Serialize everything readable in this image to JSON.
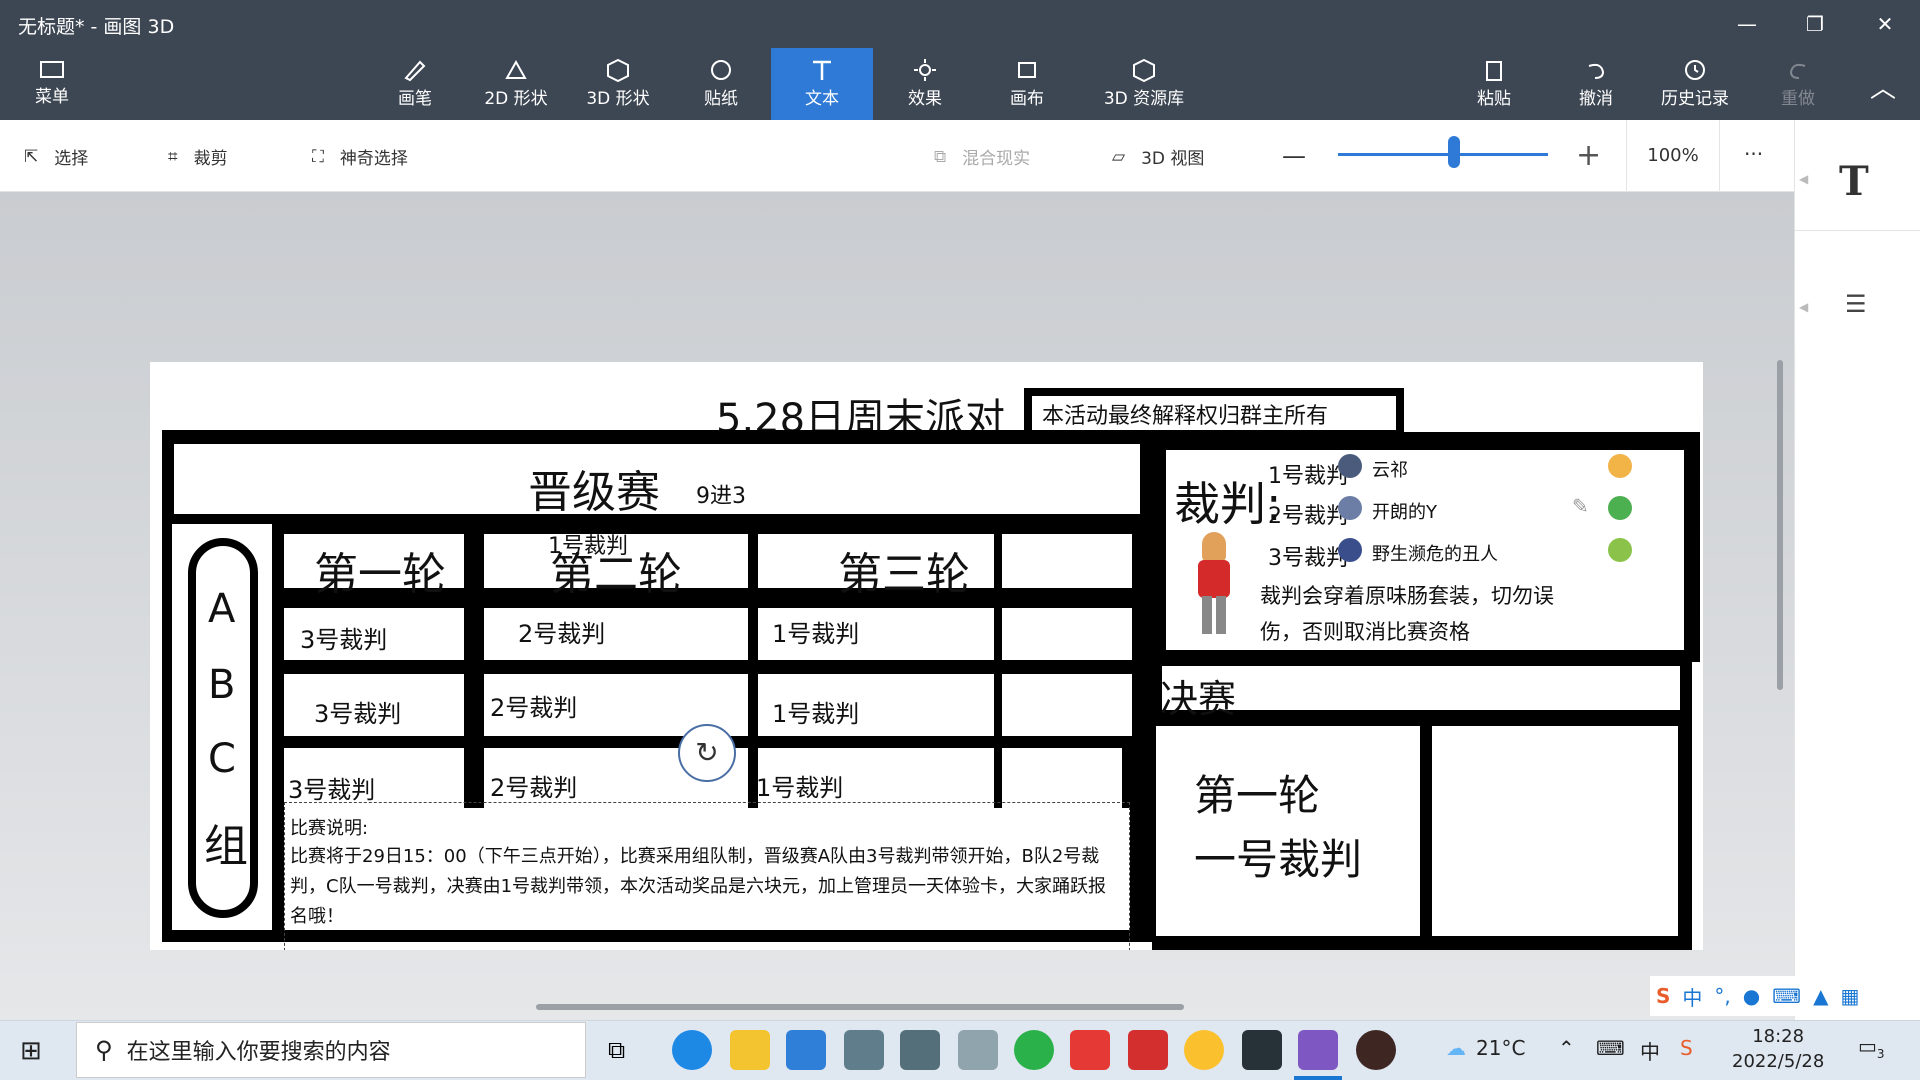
{
  "window": {
    "title": "无标题* - 画图 3D",
    "minimize": "—",
    "maximize": "❐",
    "close": "✕"
  },
  "ribbon": {
    "menu": "菜单",
    "tools": [
      "画笔",
      "2D 形状",
      "3D 形状",
      "贴纸",
      "文本",
      "效果",
      "画布",
      "3D 资源库"
    ],
    "active": "文本",
    "right": [
      "粘贴",
      "撤消",
      "历史记录",
      "重做"
    ]
  },
  "subbar": {
    "select": "选择",
    "crop": "裁剪",
    "magic": "神奇选择",
    "mixed": "混合现实",
    "view3d": "3D 视图",
    "zoom": "100%",
    "zoom_value": 0.55,
    "more": "···"
  },
  "panel": {
    "text_icon": "T"
  },
  "poster": {
    "title": "5.28日周末派对",
    "notice": "本活动最终解释权归群主所有",
    "promo": "晋级赛",
    "promo_sub": "9进3",
    "rounds": [
      "第一轮",
      "第二轮",
      "第三轮"
    ],
    "round2_overlay": "1号裁判",
    "groups": [
      "A",
      "B",
      "C",
      "组"
    ],
    "grid": [
      [
        "3号裁判",
        "2号裁判",
        "1号裁判"
      ],
      [
        "3号裁判",
        "2号裁判",
        "1号裁判"
      ],
      [
        "3号裁判",
        "2号裁判",
        "1号裁判"
      ]
    ],
    "judge_title": "裁判:",
    "judges": [
      {
        "n": "1号裁判",
        "name": "云祁"
      },
      {
        "n": "2号裁判",
        "name": "开朗的Y"
      },
      {
        "n": "3号裁判",
        "name": "野生濒危的丑人"
      }
    ],
    "judge_note": "裁判会穿着原味肠套装，切勿误伤，否则取消比赛资格",
    "final": "决赛",
    "final_round": "第一轮",
    "final_judge": "一号裁判",
    "desc_title": "比赛说明:",
    "desc": "比赛将于29日15：00（下午三点开始），比赛采用组队制，晋级赛A队由3号裁判带领开始，B队2号裁判，C队一号裁判，决赛由1号裁判带领，本次活动奖品是六块元，加上管理员一天体验卡，大家踊跃报名哦！"
  },
  "taskbar": {
    "search_placeholder": "在这里输入你要搜索的内容",
    "weather": "21°C",
    "time": "18:28",
    "date": "2022/5/28",
    "ime": "中",
    "notif": "3"
  }
}
